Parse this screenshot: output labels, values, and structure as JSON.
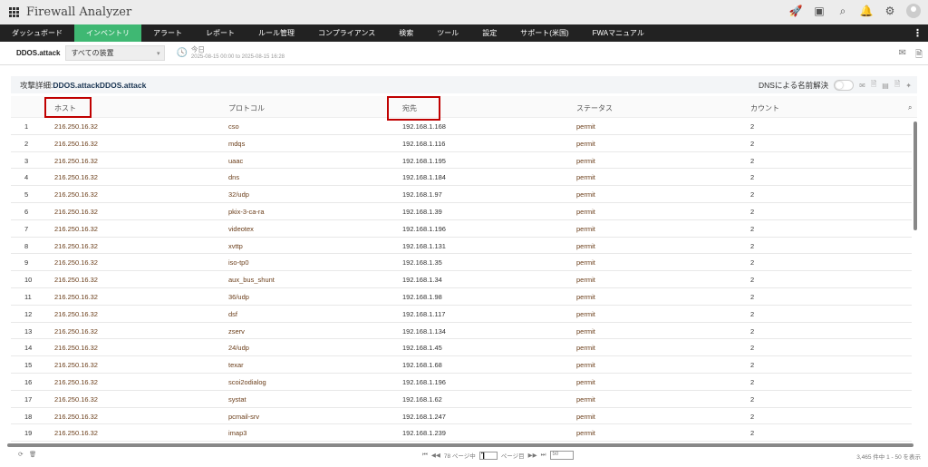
{
  "app": {
    "title": "Firewall Analyzer"
  },
  "nav": [
    "ダッシュボード",
    "インベントリ",
    "アラート",
    "レポート",
    "ルール管理",
    "コンプライアンス",
    "検索",
    "ツール",
    "設定",
    "サポート(米国)",
    "FWAマニュアル"
  ],
  "sub": {
    "device_name": "DDOS.attack",
    "device_select": "すべての装置",
    "period_label": "今日",
    "period_range": "2025-08-15 00:00 to 2025-08-15 16:28"
  },
  "panel": {
    "title_prefix": "攻撃詳細: ",
    "title_value": "DDOS.attackDDOS.attack",
    "dns_label": "DNSによる名前解決"
  },
  "columns": [
    "ホスト",
    "プロトコル",
    "宛先",
    "ステータス",
    "カウント"
  ],
  "rows": [
    [
      "1",
      "216.250.16.32",
      "cso",
      "192.168.1.168",
      "permit",
      "2"
    ],
    [
      "2",
      "216.250.16.32",
      "mdqs",
      "192.168.1.116",
      "permit",
      "2"
    ],
    [
      "3",
      "216.250.16.32",
      "uaac",
      "192.168.1.195",
      "permit",
      "2"
    ],
    [
      "4",
      "216.250.16.32",
      "dns",
      "192.168.1.184",
      "permit",
      "2"
    ],
    [
      "5",
      "216.250.16.32",
      "32/udp",
      "192.168.1.97",
      "permit",
      "2"
    ],
    [
      "6",
      "216.250.16.32",
      "pkix-3-ca-ra",
      "192.168.1.39",
      "permit",
      "2"
    ],
    [
      "7",
      "216.250.16.32",
      "videotex",
      "192.168.1.196",
      "permit",
      "2"
    ],
    [
      "8",
      "216.250.16.32",
      "xvttp",
      "192.168.1.131",
      "permit",
      "2"
    ],
    [
      "9",
      "216.250.16.32",
      "iso-tp0",
      "192.168.1.35",
      "permit",
      "2"
    ],
    [
      "10",
      "216.250.16.32",
      "aux_bus_shunt",
      "192.168.1.34",
      "permit",
      "2"
    ],
    [
      "11",
      "216.250.16.32",
      "36/udp",
      "192.168.1.98",
      "permit",
      "2"
    ],
    [
      "12",
      "216.250.16.32",
      "dsf",
      "192.168.1.117",
      "permit",
      "2"
    ],
    [
      "13",
      "216.250.16.32",
      "zserv",
      "192.168.1.134",
      "permit",
      "2"
    ],
    [
      "14",
      "216.250.16.32",
      "24/udp",
      "192.168.1.45",
      "permit",
      "2"
    ],
    [
      "15",
      "216.250.16.32",
      "texar",
      "192.168.1.68",
      "permit",
      "2"
    ],
    [
      "16",
      "216.250.16.32",
      "scoi2odialog",
      "192.168.1.196",
      "permit",
      "2"
    ],
    [
      "17",
      "216.250.16.32",
      "systat",
      "192.168.1.62",
      "permit",
      "2"
    ],
    [
      "18",
      "216.250.16.32",
      "pcmail-srv",
      "192.168.1.247",
      "permit",
      "2"
    ],
    [
      "19",
      "216.250.16.32",
      "imap3",
      "192.168.1.239",
      "permit",
      "2"
    ]
  ],
  "footer": {
    "pages_text": "78 ページ中",
    "page_value": "1",
    "page_suffix": "ページ目",
    "page_size": "50",
    "count_text": "3,465 件中 1 - 50 を表示"
  }
}
